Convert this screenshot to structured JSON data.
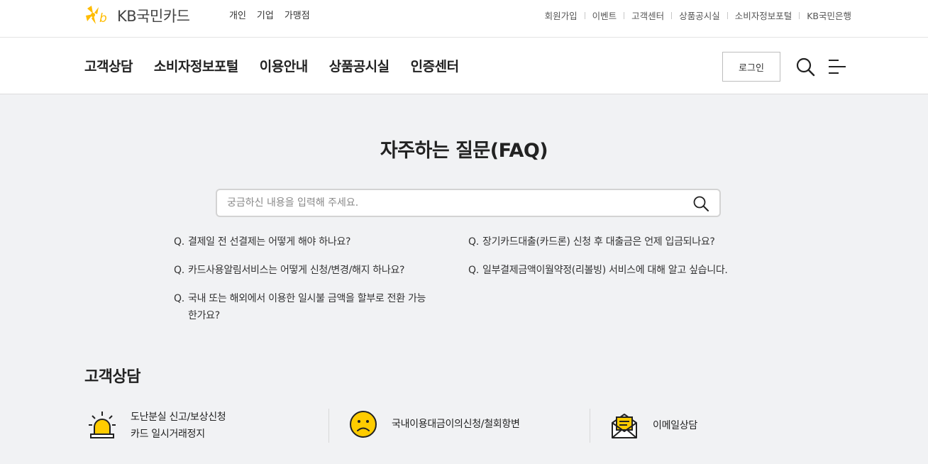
{
  "brand": {
    "name": "KB국민카드"
  },
  "segments": [
    "개인",
    "기업",
    "가맹점"
  ],
  "util_links": [
    "회원가입",
    "이벤트",
    "고객센터",
    "상품공시실",
    "소비자정보포털",
    "KB국민은행"
  ],
  "gnb": {
    "menu": [
      "고객상담",
      "소비자정보포털",
      "이용안내",
      "상품공시실",
      "인증센터"
    ],
    "login_label": "로그인"
  },
  "faq": {
    "title": "자주하는 질문(FAQ)",
    "search_placeholder": "궁금하신 내용을 입력해 주세요.",
    "q_marker": "Q.",
    "questions": [
      "결제일 전 선결제는 어떻게 해야 하나요?",
      "장기카드대출(카드론) 신청 후 대출금은 언제 입금되나요?",
      "카드사용알림서비스는 어떻게 신청/변경/해지 하나요?",
      "일부결제금액이월약정(리볼빙) 서비스에 대해 알고 싶습니다.",
      "국내 또는 해외에서 이용한 일시불 금액을 할부로 전환 가능한가요?"
    ]
  },
  "customer_service": {
    "title": "고객상담",
    "items": [
      {
        "line1": "도난분실 신고/보상신청",
        "line2": "카드 일시거래정지",
        "icon": "alarm-siren-icon"
      },
      {
        "line1": "국내이용대금이의신청/철회항변",
        "line2": "",
        "icon": "sad-face-icon"
      },
      {
        "line1": "이메일상담",
        "line2": "",
        "icon": "envelope-icon"
      }
    ]
  },
  "colors": {
    "accent": "#ffcc00",
    "background": "#f1f2f4",
    "text": "#222222"
  }
}
